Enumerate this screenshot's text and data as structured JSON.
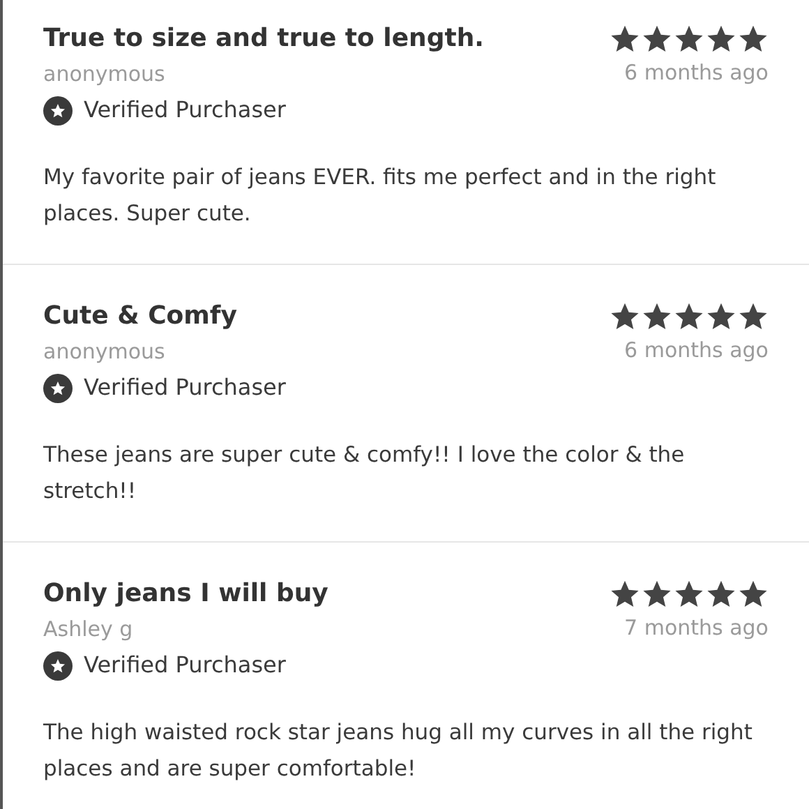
{
  "reviews": [
    {
      "title": "True to size and true to length.",
      "stars": 5,
      "author": "anonymous",
      "time": "6 months ago",
      "badge": "Verified Purchaser",
      "body": "My favorite pair of jeans EVER. fits me perfect and in the right places. Super cute."
    },
    {
      "title": "Cute & Comfy",
      "stars": 5,
      "author": "anonymous",
      "time": "6 months ago",
      "badge": "Verified Purchaser",
      "body": "These jeans are super cute & comfy!! I love the color & the stretch!!"
    },
    {
      "title": "Only jeans I will buy",
      "stars": 5,
      "author": "Ashley g",
      "time": "7 months ago",
      "badge": "Verified Purchaser",
      "body": "The high waisted rock star jeans hug all my curves in all the right places and are super comfortable!"
    }
  ]
}
